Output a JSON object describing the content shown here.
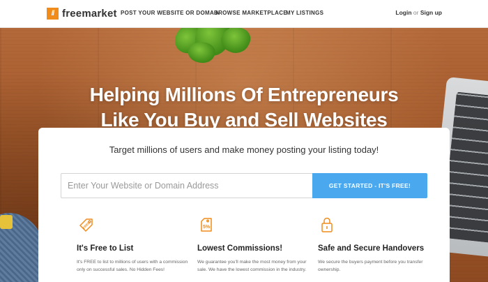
{
  "header": {
    "logo_mark": "//",
    "logo_text": "freemarket",
    "nav": [
      {
        "label": "POST YOUR WEBSITE OR DOMAIN"
      },
      {
        "label": "BROWSE MARKETPLACE"
      },
      {
        "label": "MY LISTINGS"
      }
    ],
    "login": "Login",
    "or": "or",
    "signup": "Sign up"
  },
  "hero": {
    "title_line1": "Helping Millions Of Entrepreneurs",
    "title_line2": "Like You Buy and Sell Websites"
  },
  "card": {
    "tagline": "Target millions of users and make money posting your listing today!",
    "input_placeholder": "Enter Your Website or Domain Address",
    "cta_label": "GET STARTED - IT'S FREE!"
  },
  "features": [
    {
      "icon": "free-tag-icon",
      "title": "It's Free to List",
      "desc": "It's FREE to list to millions of users with a commission only on successful sales. No Hidden Fees!"
    },
    {
      "icon": "percent-tag-icon",
      "title": "Lowest Commissions!",
      "desc": "We guarantee you'll make the most money from your sale. We have the lowest commission in the industry."
    },
    {
      "icon": "lock-icon",
      "title": "Safe and Secure Handovers",
      "desc": "We secure the buyers payment before you transfer ownership."
    }
  ],
  "colors": {
    "brand_orange": "#f08c1c",
    "cta_blue": "#4aa8ef"
  }
}
